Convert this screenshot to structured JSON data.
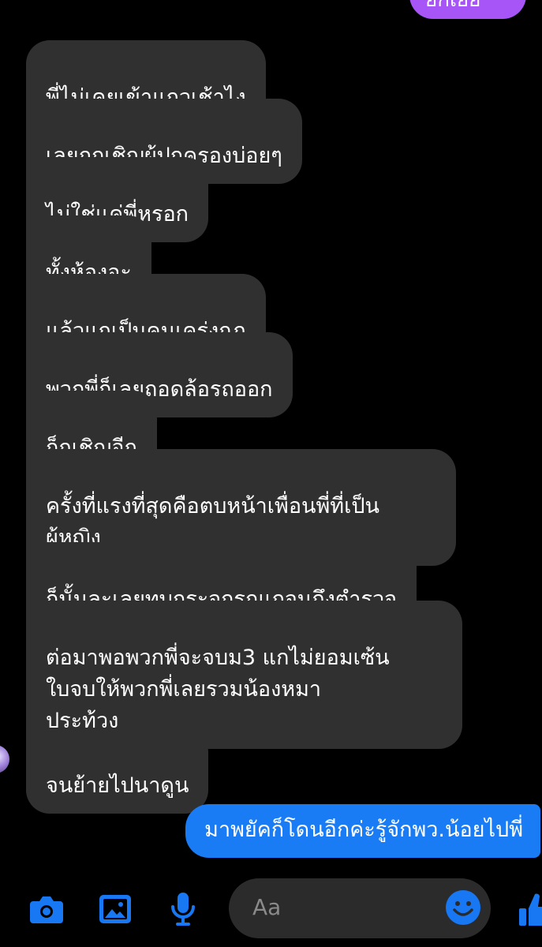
{
  "colors": {
    "background": "#000000",
    "received_bubble": "#303030",
    "sent_bubble": "#1a7cf5",
    "accent_blue": "#1877f2",
    "partial_bubble": "#a855f7"
  },
  "top_partial_bubble": {
    "text": "ยกเยย"
  },
  "received_messages": [
    "พี่ไม่เคยเข้าแถวเช้าไง",
    "เลยถูกเชิญผู้ปกครองบ่อยๆ",
    "ไม่ใช่แค่พี่หรอก",
    "ทั้งห้องอะ",
    "แล้วแกเป็นคนเคร่งกฏ",
    "พวกพี่ก็เลยถอดล้อรถออก",
    "ก็กูเชิญอีก",
    "ครั้งที่แรงที่สุดคือตบหน้าเพื่อนพี่ที่เป็น\nผู้หญิง",
    "ก็นั้นละเลยทุบกระจกรถแกจนถึงตำรวจ",
    "ต่อมาพอพวกพี่จะจบม3 แกไม่ยอมเซ้น\nใบจบให้พวกพี่เลยรวมน้องหมา\nประท้วง",
    "จนย้ายไปนาดูน"
  ],
  "sent_message": "มาพยัคก็โดนอีกค่ะรู้จักพว.น้อยไปพี่",
  "composer": {
    "placeholder": "Aa",
    "icons": [
      "camera-icon",
      "image-icon",
      "microphone-icon",
      "emoji-icon",
      "thumbs-up-icon"
    ]
  }
}
